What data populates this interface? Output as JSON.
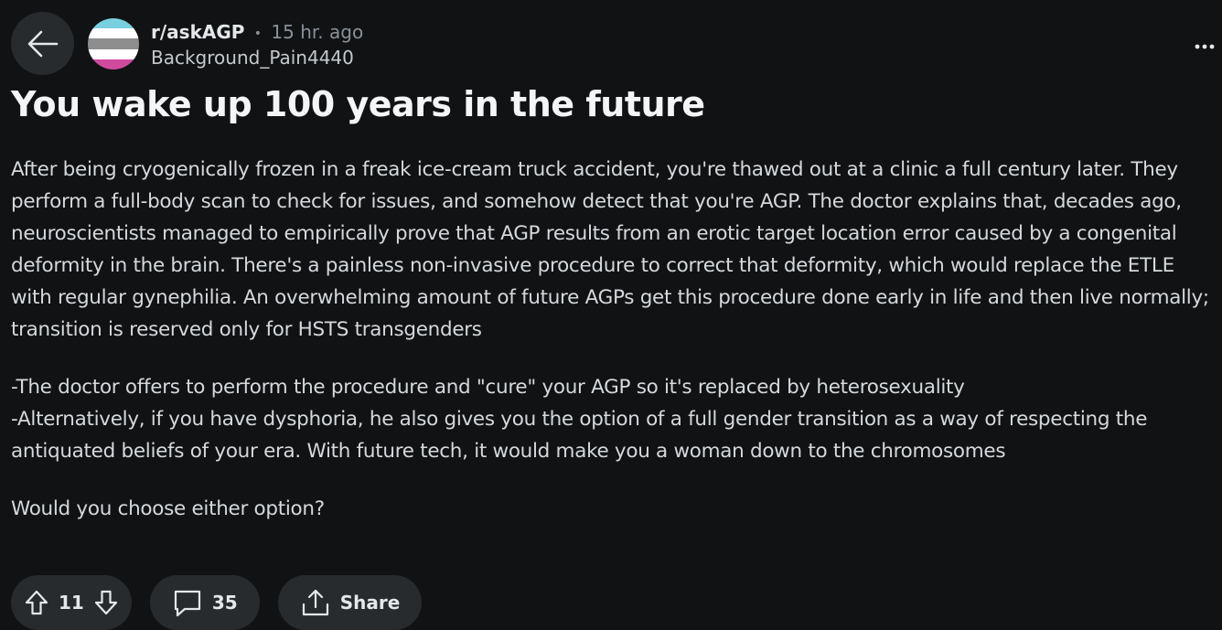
{
  "header": {
    "subreddit": "r/askAGP",
    "separator": "•",
    "time": "15 hr. ago",
    "author": "Background_Pain4440",
    "avatar_colors": [
      "#78cfe0",
      "#ffffff",
      "#8e8e8e",
      "#d04a9e"
    ]
  },
  "post": {
    "title": "You wake up 100 years in the future",
    "paragraphs": [
      "After being cryogenically frozen in a freak ice-cream truck accident, you're thawed out at a clinic a full century later. They perform a full-body scan to check for issues, and somehow detect that you're AGP. The doctor explains that, decades ago, neuroscientists managed to empirically prove that AGP results from an erotic target location error caused by a congenital deformity in the brain. There's a painless non-invasive procedure to correct that deformity, which would replace the ETLE with regular gynephilia. An overwhelming amount of future AGPs get this procedure done early in life and then live normally; transition is reserved only for HSTS transgenders",
      "-The doctor offers to perform the procedure and \"cure\" your AGP so it's replaced by heterosexuality\n-Alternatively, if you have dysphoria, he also gives you the option of a full gender transition as a way of respecting the antiquated beliefs of your era. With future tech, it would make you a woman down to the chromosomes",
      "Would you choose either option?"
    ]
  },
  "actions": {
    "votes": "11",
    "comments": "35",
    "share": "Share"
  },
  "icons": {
    "back": "back-arrow-icon",
    "overflow": "more-options-icon",
    "upvote": "upvote-arrow-icon",
    "downvote": "downvote-arrow-icon",
    "comment": "comment-bubble-icon",
    "share": "share-icon"
  }
}
